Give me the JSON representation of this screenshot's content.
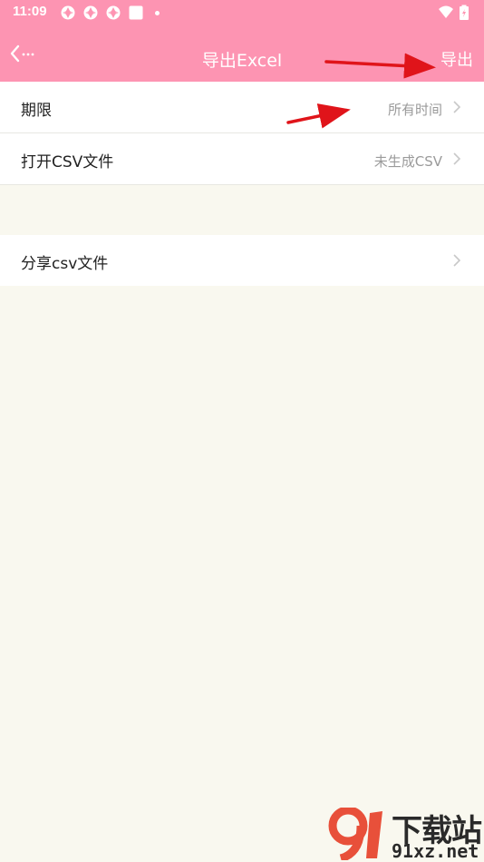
{
  "status_bar": {
    "time": "11:09",
    "icons": [
      "app-notification-icon",
      "app-notification-icon",
      "app-notification-icon",
      "square-notification-icon",
      "dot-icon",
      "wifi-icon",
      "battery-icon"
    ]
  },
  "app_bar": {
    "back_icon": "back-arrow-icon",
    "title": "导出Excel",
    "action_label": "导出"
  },
  "settings": [
    {
      "label": "期限",
      "value": "所有时间",
      "icon": "chevron-right-icon"
    },
    {
      "label": "打开CSV文件",
      "value": "未生成CSV",
      "icon": "chevron-right-icon"
    },
    {
      "label": "分享csv文件",
      "value": "",
      "icon": "chevron-right-icon"
    }
  ],
  "watermark": {
    "main": "下载站",
    "site": "91xz.net"
  },
  "colors": {
    "accent": "#fd94b2",
    "background": "#f9f8ef",
    "annotation_arrow": "#e0141a"
  }
}
